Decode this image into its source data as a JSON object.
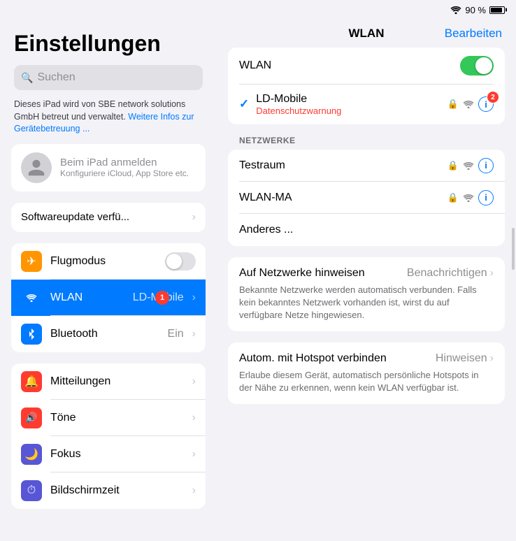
{
  "statusBar": {
    "battery": "90 %",
    "wifiSignal": "wifi"
  },
  "sidebar": {
    "title": "Einstellungen",
    "search": {
      "placeholder": "Suchen"
    },
    "infoText": "Dieses iPad wird von SBE network solutions GmbH betreut und verwaltet.",
    "infoLink": "Weitere Infos zur Gerätebetreuung ...",
    "account": {
      "main": "Beim iPad anmelden",
      "sub": "Konfiguriere iCloud, App Store etc."
    },
    "updateRow": {
      "label": "Softwareupdate verfü...",
      "hasChevron": true
    },
    "items": [
      {
        "id": "flugmodus",
        "label": "Flugmodus",
        "iconBg": "#ff9500",
        "icon": "✈",
        "hasToggle": true,
        "toggleOn": false
      },
      {
        "id": "wlan",
        "label": "WLAN",
        "iconBg": "#007aff",
        "icon": "wifi",
        "value": "LD-Mobile",
        "active": true,
        "badge": "1"
      },
      {
        "id": "bluetooth",
        "label": "Bluetooth",
        "iconBg": "#007aff",
        "icon": "bluetooth",
        "value": "Ein"
      }
    ],
    "items2": [
      {
        "id": "mitteilungen",
        "label": "Mitteilungen",
        "iconBg": "#ff3b30",
        "icon": "🔔"
      },
      {
        "id": "toene",
        "label": "Töne",
        "iconBg": "#ff3b30",
        "icon": "🔊"
      },
      {
        "id": "fokus",
        "label": "Fokus",
        "iconBg": "#5856d6",
        "icon": "🌙"
      },
      {
        "id": "bildschirmzeit",
        "label": "Bildschirmzeit",
        "iconBg": "#5856d6",
        "icon": "⏱"
      }
    ]
  },
  "rightPanel": {
    "title": "WLAN",
    "editButton": "Bearbeiten",
    "wlanToggleLabel": "WLAN",
    "connectedNetwork": {
      "name": "LD-Mobile",
      "warning": "Datenschutzwarnung",
      "badge": "2"
    },
    "networksSectionLabel": "NETZWERKE",
    "networks": [
      {
        "name": "Testraum"
      },
      {
        "name": "WLAN-MA"
      },
      {
        "name": "Anderes ..."
      }
    ],
    "infoSections": [
      {
        "title": "Auf Netzwerke hinweisen",
        "value": "Benachrichtigen",
        "hasChevron": true,
        "desc": "Bekannte Netzwerke werden automatisch verbunden. Falls kein bekanntes Netzwerk vorhanden ist, wirst du auf verfügbare Netze hingewiesen."
      },
      {
        "title": "Autom. mit Hotspot verbinden",
        "value": "Hinweisen",
        "hasChevron": true,
        "desc": "Erlaube diesem Gerät, automatisch persönliche Hotspots in der Nähe zu erkennen, wenn kein WLAN verfügbar ist."
      }
    ]
  }
}
